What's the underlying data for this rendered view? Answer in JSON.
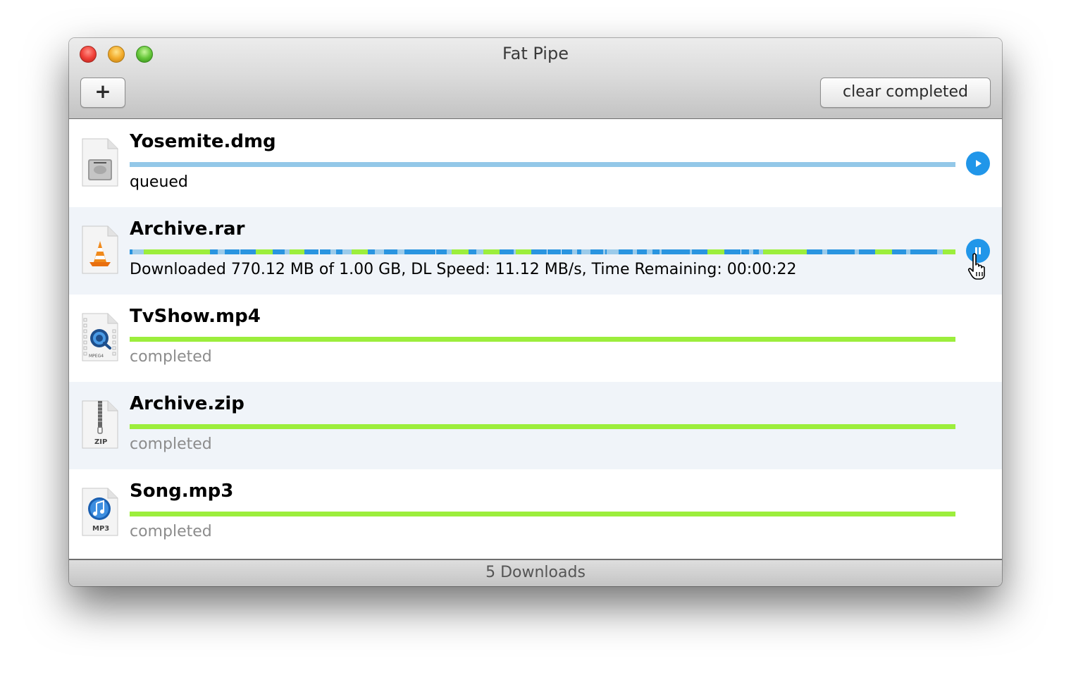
{
  "window": {
    "title": "Fat Pipe",
    "add_button_label": "+",
    "clear_button_label": "clear completed",
    "footer": "5 Downloads"
  },
  "colors": {
    "queued_bar": "#93c8e8",
    "progress_blue": "#2a95e0",
    "progress_light": "#9ccbea",
    "progress_green": "#9cee3c",
    "completed_bar": "#9cee3c",
    "action_button": "#2196e9"
  },
  "downloads": [
    {
      "name": "Yosemite.dmg",
      "icon": "disk-image-icon",
      "status": "queued",
      "state": "queued",
      "progress": 0,
      "action": "play"
    },
    {
      "name": "Archive.rar",
      "icon": "vlc-cone-icon",
      "status": "Downloaded 770.12 MB of 1.00 GB, DL Speed: 11.12 MB/s, Time Remaining: 00:00:22",
      "state": "downloading",
      "progress": 0.75,
      "action": "pause",
      "segments": [
        {
          "from": 0.0,
          "to": 0.003,
          "kind": "blue"
        },
        {
          "from": 0.003,
          "to": 0.017,
          "kind": "light"
        },
        {
          "from": 0.017,
          "to": 0.097,
          "kind": "green"
        },
        {
          "from": 0.097,
          "to": 0.107,
          "kind": "blue"
        },
        {
          "from": 0.107,
          "to": 0.115,
          "kind": "light"
        },
        {
          "from": 0.115,
          "to": 0.133,
          "kind": "blue"
        },
        {
          "from": 0.134,
          "to": 0.153,
          "kind": "blue"
        },
        {
          "from": 0.153,
          "to": 0.173,
          "kind": "green"
        },
        {
          "from": 0.173,
          "to": 0.188,
          "kind": "blue"
        },
        {
          "from": 0.188,
          "to": 0.194,
          "kind": "light"
        },
        {
          "from": 0.194,
          "to": 0.212,
          "kind": "green"
        },
        {
          "from": 0.212,
          "to": 0.229,
          "kind": "blue"
        },
        {
          "from": 0.23,
          "to": 0.243,
          "kind": "blue"
        },
        {
          "from": 0.243,
          "to": 0.25,
          "kind": "light"
        },
        {
          "from": 0.25,
          "to": 0.258,
          "kind": "blue"
        },
        {
          "from": 0.258,
          "to": 0.269,
          "kind": "light"
        },
        {
          "from": 0.269,
          "to": 0.288,
          "kind": "green"
        },
        {
          "from": 0.288,
          "to": 0.297,
          "kind": "blue"
        },
        {
          "from": 0.297,
          "to": 0.308,
          "kind": "light"
        },
        {
          "from": 0.308,
          "to": 0.324,
          "kind": "blue"
        },
        {
          "from": 0.324,
          "to": 0.333,
          "kind": "light"
        },
        {
          "from": 0.333,
          "to": 0.37,
          "kind": "blue"
        },
        {
          "from": 0.371,
          "to": 0.384,
          "kind": "blue"
        },
        {
          "from": 0.384,
          "to": 0.39,
          "kind": "light"
        },
        {
          "from": 0.39,
          "to": 0.41,
          "kind": "green"
        },
        {
          "from": 0.41,
          "to": 0.42,
          "kind": "blue"
        },
        {
          "from": 0.42,
          "to": 0.428,
          "kind": "light"
        },
        {
          "from": 0.428,
          "to": 0.448,
          "kind": "green"
        },
        {
          "from": 0.448,
          "to": 0.465,
          "kind": "blue"
        },
        {
          "from": 0.465,
          "to": 0.468,
          "kind": "light"
        },
        {
          "from": 0.468,
          "to": 0.486,
          "kind": "green"
        },
        {
          "from": 0.486,
          "to": 0.505,
          "kind": "blue"
        },
        {
          "from": 0.506,
          "to": 0.522,
          "kind": "blue"
        },
        {
          "from": 0.523,
          "to": 0.536,
          "kind": "blue"
        },
        {
          "from": 0.536,
          "to": 0.542,
          "kind": "light"
        },
        {
          "from": 0.542,
          "to": 0.547,
          "kind": "blue"
        },
        {
          "from": 0.547,
          "to": 0.558,
          "kind": "light"
        },
        {
          "from": 0.558,
          "to": 0.573,
          "kind": "blue"
        },
        {
          "from": 0.573,
          "to": 0.576,
          "kind": "light"
        },
        {
          "from": 0.576,
          "to": 0.578,
          "kind": "blue"
        },
        {
          "from": 0.578,
          "to": 0.592,
          "kind": "light"
        },
        {
          "from": 0.592,
          "to": 0.609,
          "kind": "blue"
        },
        {
          "from": 0.609,
          "to": 0.614,
          "kind": "light"
        },
        {
          "from": 0.614,
          "to": 0.626,
          "kind": "blue"
        },
        {
          "from": 0.626,
          "to": 0.633,
          "kind": "light"
        },
        {
          "from": 0.633,
          "to": 0.642,
          "kind": "blue"
        },
        {
          "from": 0.642,
          "to": 0.644,
          "kind": "light"
        },
        {
          "from": 0.644,
          "to": 0.678,
          "kind": "blue"
        },
        {
          "from": 0.678,
          "to": 0.681,
          "kind": "light"
        },
        {
          "from": 0.681,
          "to": 0.7,
          "kind": "blue"
        },
        {
          "from": 0.7,
          "to": 0.72,
          "kind": "green"
        },
        {
          "from": 0.72,
          "to": 0.74,
          "kind": "blue"
        },
        {
          "from": 0.741,
          "to": 0.75,
          "kind": "blue"
        },
        {
          "from": 0.75,
          "to": 0.755,
          "kind": "light"
        },
        {
          "from": 0.755,
          "to": 0.762,
          "kind": "blue"
        },
        {
          "from": 0.762,
          "to": 0.767,
          "kind": "light"
        },
        {
          "from": 0.767,
          "to": 0.82,
          "kind": "green"
        },
        {
          "from": 0.82,
          "to": 0.839,
          "kind": "blue"
        },
        {
          "from": 0.839,
          "to": 0.845,
          "kind": "light"
        },
        {
          "from": 0.845,
          "to": 0.878,
          "kind": "blue"
        },
        {
          "from": 0.878,
          "to": 0.883,
          "kind": "light"
        },
        {
          "from": 0.883,
          "to": 0.903,
          "kind": "blue"
        },
        {
          "from": 0.903,
          "to": 0.923,
          "kind": "green"
        },
        {
          "from": 0.923,
          "to": 0.94,
          "kind": "blue"
        },
        {
          "from": 0.94,
          "to": 0.945,
          "kind": "light"
        },
        {
          "from": 0.945,
          "to": 0.978,
          "kind": "blue"
        },
        {
          "from": 0.978,
          "to": 0.985,
          "kind": "light"
        },
        {
          "from": 0.985,
          "to": 1.0,
          "kind": "green"
        }
      ]
    },
    {
      "name": "TvShow.mp4",
      "icon": "quicktime-mpeg4-icon",
      "icon_label": "MPEG4",
      "status": "completed",
      "state": "completed",
      "progress": 1.0
    },
    {
      "name": "Archive.zip",
      "icon": "zip-archive-icon",
      "icon_label": "ZIP",
      "status": "completed",
      "state": "completed",
      "progress": 1.0
    },
    {
      "name": "Song.mp3",
      "icon": "itunes-mp3-icon",
      "icon_label": "MP3",
      "status": "completed",
      "state": "completed",
      "progress": 1.0
    }
  ]
}
